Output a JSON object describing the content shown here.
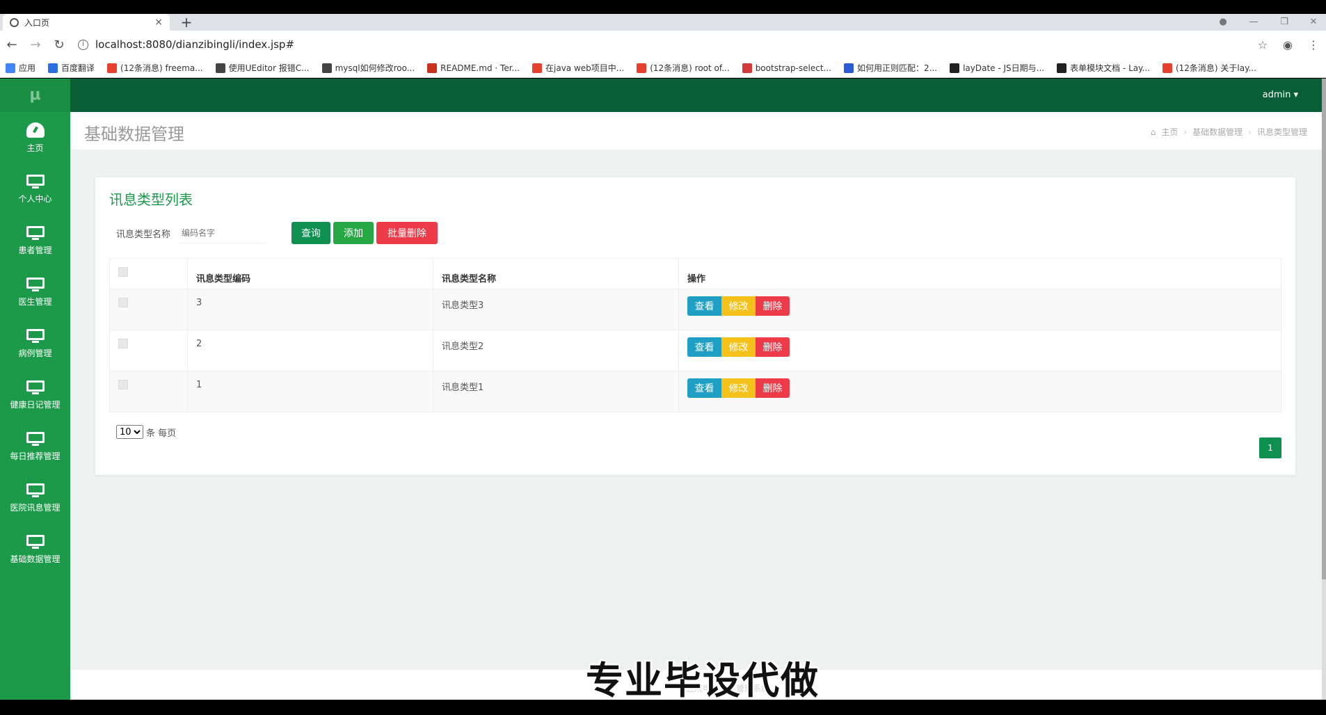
{
  "browser": {
    "tab_title": "入口页",
    "tab_close": "×",
    "new_tab": "+",
    "url": "localhost:8080/dianzibingli/index.jsp#",
    "bookmarks": [
      {
        "label": "应用",
        "color": "#4285f4"
      },
      {
        "label": "百度翻译",
        "color": "#2b6fe0"
      },
      {
        "label": "(12条消息) freema...",
        "color": "#e5412d"
      },
      {
        "label": "使用UEditor 报错C...",
        "color": "#444444"
      },
      {
        "label": "mysql如何修改roo...",
        "color": "#444444"
      },
      {
        "label": "README.md · Ter...",
        "color": "#c7331f"
      },
      {
        "label": "在java web项目中...",
        "color": "#e5412d"
      },
      {
        "label": "(12条消息) root of...",
        "color": "#e5412d"
      },
      {
        "label": "bootstrap-select...",
        "color": "#d33b3b"
      },
      {
        "label": "如何用正则匹配：2...",
        "color": "#2e5bd6"
      },
      {
        "label": "layDate - JS日期与...",
        "color": "#222222"
      },
      {
        "label": "表单模块文档 - Lay...",
        "color": "#222222"
      },
      {
        "label": "(12条消息) 关于lay...",
        "color": "#e5412d"
      }
    ]
  },
  "sidebar": {
    "logo": "μ",
    "items": [
      {
        "label": "主页",
        "icon": "dashboard-icon"
      },
      {
        "label": "个人中心",
        "icon": "monitor-icon"
      },
      {
        "label": "患者管理",
        "icon": "monitor-icon"
      },
      {
        "label": "医生管理",
        "icon": "monitor-icon"
      },
      {
        "label": "病例管理",
        "icon": "monitor-icon"
      },
      {
        "label": "健康日记管理",
        "icon": "monitor-icon"
      },
      {
        "label": "每日推荐管理",
        "icon": "monitor-icon"
      },
      {
        "label": "医院讯息管理",
        "icon": "monitor-icon"
      },
      {
        "label": "基础数据管理",
        "icon": "monitor-icon"
      }
    ]
  },
  "header": {
    "user": "admin ▾"
  },
  "page": {
    "title": "基础数据管理",
    "breadcrumb": [
      "主页",
      "基础数据管理",
      "讯息类型管理"
    ]
  },
  "card": {
    "title": "讯息类型列表",
    "search_label": "讯息类型名称",
    "search_placeholder": "编码名字",
    "query_btn": "查询",
    "add_btn": "添加",
    "batch_delete_btn": "批量删除"
  },
  "table": {
    "headers": [
      "讯息类型编码",
      "讯息类型名称",
      "操作"
    ],
    "rows": [
      {
        "code": "3",
        "name": "讯息类型3"
      },
      {
        "code": "2",
        "name": "讯息类型2"
      },
      {
        "code": "1",
        "name": "讯息类型1"
      }
    ],
    "ops": {
      "view": "查看",
      "edit": "修改",
      "delete": "删除"
    }
  },
  "pager": {
    "page_size": "10",
    "suffix": "条 每页",
    "current_page": "1"
  },
  "footer": {
    "text": "医院电子病历管理系统"
  },
  "watermark": "专业毕设代做",
  "colors": {
    "sidebar": "#1c9a4a",
    "header": "#085f37",
    "primary": "#0f8f50",
    "danger": "#ee3b4a",
    "warning": "#f4c21b",
    "info": "#1f9fc4"
  }
}
